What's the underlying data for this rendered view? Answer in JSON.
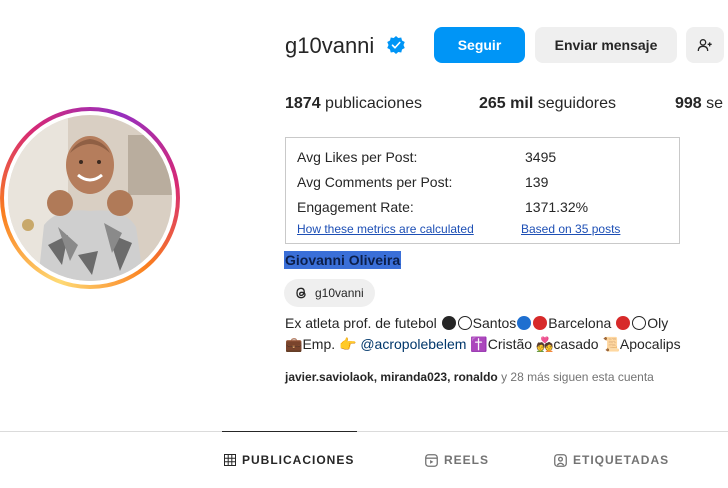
{
  "profile": {
    "username": "g10vanni",
    "full_name": "Giovanni Oliveira",
    "threads_handle": "g10vanni"
  },
  "actions": {
    "follow_label": "Seguir",
    "message_label": "Enviar mensaje"
  },
  "stats": {
    "posts_count": "1874",
    "posts_label": "publicaciones",
    "followers_count": "265 mil",
    "followers_label": "seguidores",
    "following_count": "998",
    "following_label": "se"
  },
  "metrics": {
    "avg_likes_label": "Avg Likes per Post:",
    "avg_likes_value": "3495",
    "avg_comments_label": "Avg Comments per Post:",
    "avg_comments_value": "139",
    "engagement_label": "Engagement Rate:",
    "engagement_value": "1371.32%",
    "how_link": "How these metrics are calculated",
    "based_link": "Based on 35 posts"
  },
  "bio": {
    "line1_a": "Ex atleta prof. de futebol",
    "line1_b": "Santos",
    "line1_c": "Barcelona",
    "line1_d": "Oly",
    "line2_a": "Emp.",
    "line2_mention": "@acropolebelem",
    "line2_b": "Cristão",
    "line2_c": "casado",
    "line2_d": "Apocalips"
  },
  "followed_by": {
    "names": "javier.saviolaok, miranda023, ronaldo",
    "suffix": " y 28 más siguen esta cuenta"
  },
  "tabs": [
    {
      "label": "PUBLICACIONES",
      "icon": "grid-icon",
      "active": true
    },
    {
      "label": "REELS",
      "icon": "reels-icon",
      "active": false
    },
    {
      "label": "ETIQUETADAS",
      "icon": "tagged-icon",
      "active": false
    }
  ],
  "colors": {
    "follow_button": "#0095f6",
    "secondary_button": "#efefef",
    "verified": "#0095f6",
    "name_highlight": "#3a6fd8",
    "link": "#1d4fb5"
  }
}
